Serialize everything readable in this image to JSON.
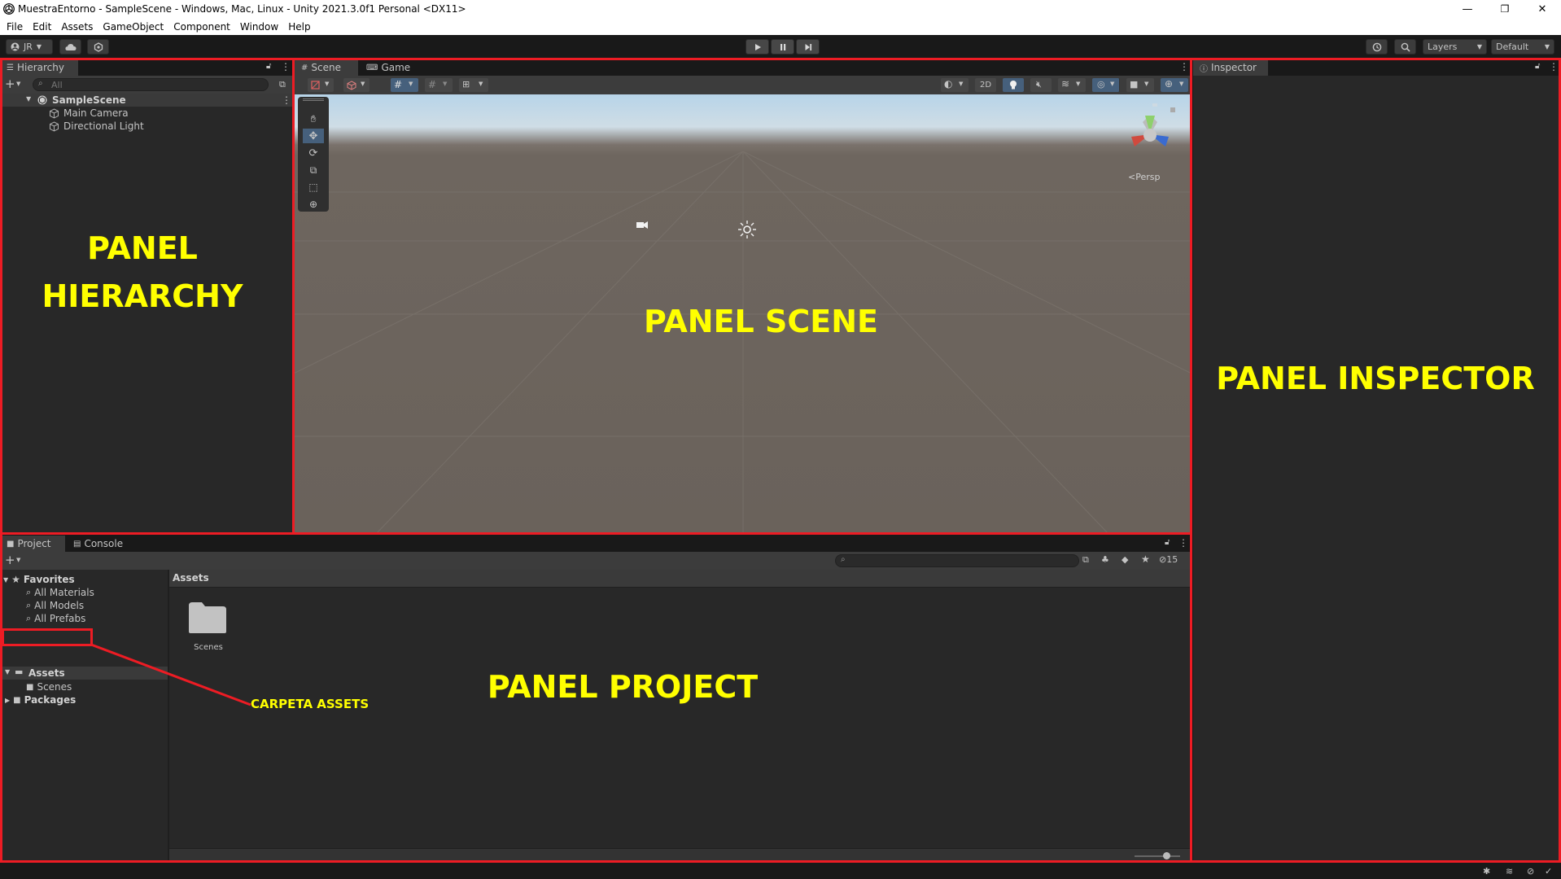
{
  "window": {
    "title": "MuestraEntorno - SampleScene - Windows, Mac, Linux - Unity 2021.3.0f1 Personal <DX11>",
    "controls": [
      "—",
      "❐",
      "✕"
    ]
  },
  "menu": [
    "File",
    "Edit",
    "Assets",
    "GameObject",
    "Component",
    "Window",
    "Help"
  ],
  "toolbar": {
    "account": "JR",
    "layers_label": "Layers",
    "layout_label": "Default"
  },
  "hierarchy": {
    "tab": "Hierarchy",
    "search_placeholder": "All",
    "scene": "SampleScene",
    "items": [
      "Main Camera",
      "Directional Light"
    ]
  },
  "scene_view": {
    "tabs": [
      "Scene",
      "Game"
    ],
    "btn_2d": "2D",
    "persp_label": "Persp"
  },
  "inspector": {
    "tab": "Inspector"
  },
  "project": {
    "tabs": [
      "Project",
      "Console"
    ],
    "favorites": {
      "label": "Favorites",
      "items": [
        "All Materials",
        "All Models",
        "All Prefabs"
      ]
    },
    "assets_label": "Assets",
    "assets_children": [
      "Scenes"
    ],
    "packages_label": "Packages",
    "breadcrumb": "Assets",
    "hidden_count": "15",
    "grid_items": [
      {
        "name": "Scenes",
        "icon": "folder-icon"
      }
    ]
  },
  "annotations": {
    "hierarchy_line1": "PANEL",
    "hierarchy_line2": "HIERARCHY",
    "scene": "PANEL SCENE",
    "inspector": "PANEL INSPECTOR",
    "project": "PANEL PROJECT",
    "assets_callout": "CARPETA ASSETS",
    "color": "#ffff00",
    "border_color": "#ed1c24"
  }
}
